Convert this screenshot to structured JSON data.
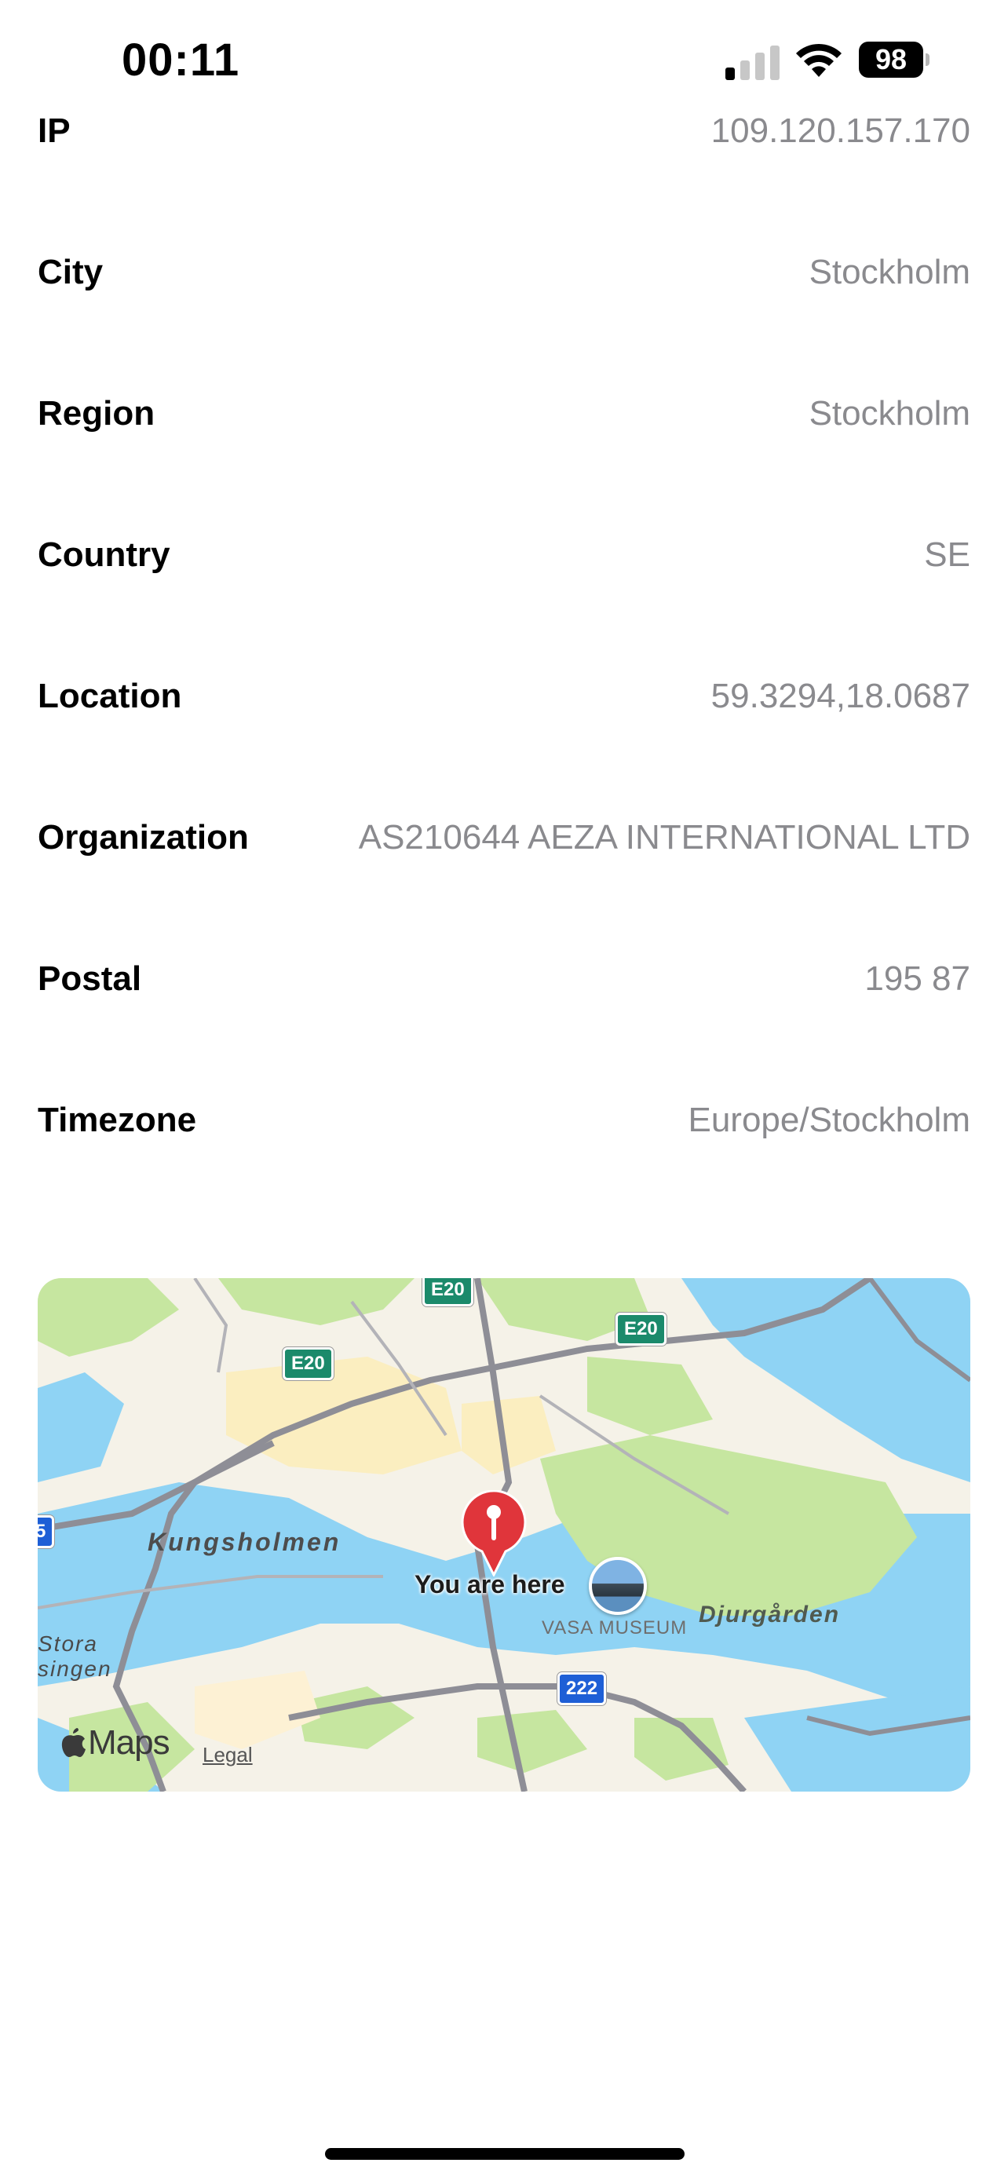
{
  "status_bar": {
    "time": "00:11",
    "battery_level": "98",
    "signal_bars_active": 1,
    "signal_bars_total": 4,
    "icons": [
      "cellular-signal-icon",
      "wifi-icon",
      "battery-icon"
    ]
  },
  "info": {
    "rows": [
      {
        "label": "IP",
        "value": "109.120.157.170"
      },
      {
        "label": "City",
        "value": "Stockholm"
      },
      {
        "label": "Region",
        "value": "Stockholm"
      },
      {
        "label": "Country",
        "value": "SE"
      },
      {
        "label": "Location",
        "value": "59.3294,18.0687"
      },
      {
        "label": "Organization",
        "value": "AS210644 AEZA INTERNATIONAL LTD"
      },
      {
        "label": "Postal",
        "value": "195 87"
      },
      {
        "label": "Timezone",
        "value": "Europe/Stockholm"
      }
    ]
  },
  "map": {
    "pin_label": "You are here",
    "places": {
      "kungsholmen": "Kungsholmen",
      "djurgarden": "Djurgården",
      "stora_line1": "Stora",
      "stora_line2": "singen",
      "vasa_museum": "VASA MUSEUM"
    },
    "road_shields": {
      "e20_a": "E20",
      "e20_b": "E20",
      "e20_c": "E20",
      "r222": "222",
      "edge_left": "5"
    },
    "provider_logo": "Maps",
    "legal_link": "Legal",
    "colors": {
      "water": "#8fd3f4",
      "park": "#c6e6a0",
      "land": "#f5f2e8",
      "pin": "#e0353b",
      "road_shield_green": "#1b8a6b",
      "road_shield_blue": "#1e5fd6"
    }
  }
}
